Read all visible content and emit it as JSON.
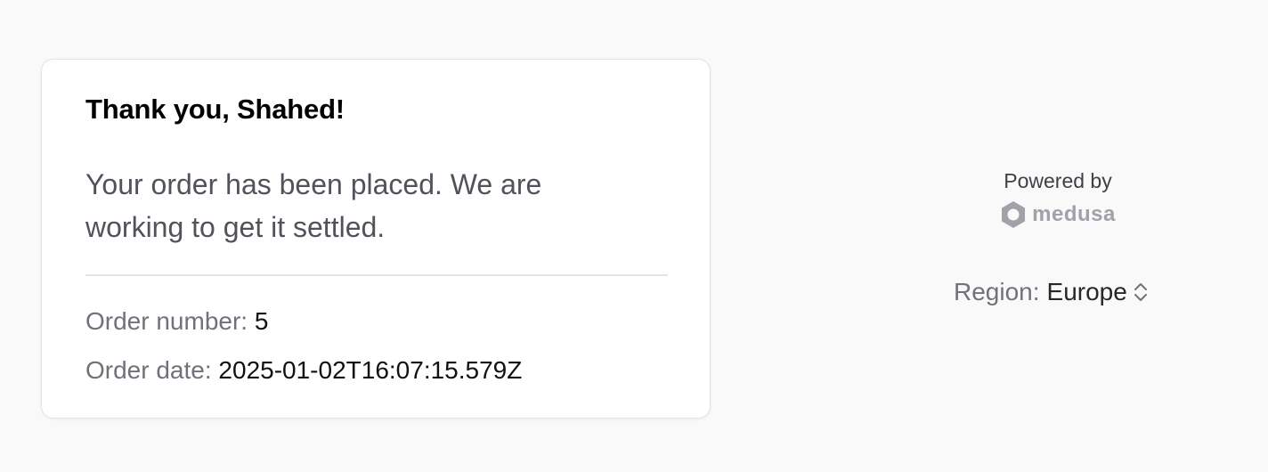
{
  "order_card": {
    "greeting": "Thank you, Shahed!",
    "message": "Your order has been placed. We are working to get it settled.",
    "order_number_label": "Order number:",
    "order_number_value": "5",
    "order_date_label": "Order date:",
    "order_date_value": "2025-01-02T16:07:15.579Z"
  },
  "footer": {
    "powered_by": "Powered by",
    "brand_name": "medusa",
    "brand_icon": "medusa-logo-icon",
    "region_label": "Region:",
    "region_value": "Europe",
    "region_icon": "chevron-up-down-icon"
  },
  "colors": {
    "background": "#f9f9f9",
    "card": "#ffffff",
    "muted_text": "#71717a",
    "brand_gray": "#a1a1aa"
  }
}
